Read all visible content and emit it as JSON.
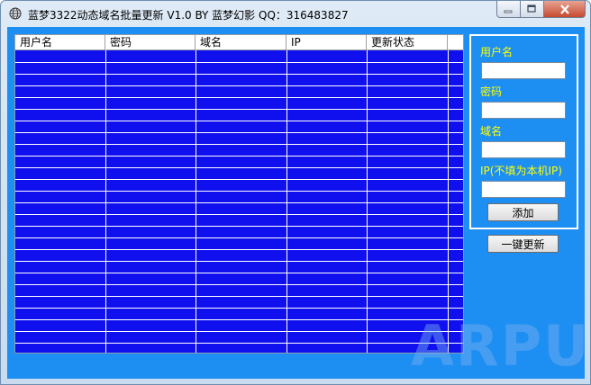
{
  "window": {
    "title": "蓝梦3322动态域名批量更新 V1.0 BY 蓝梦幻影 QQ：316483827",
    "icon": "globe-icon",
    "controls": [
      "minimize-icon",
      "maximize-icon",
      "close-icon"
    ]
  },
  "grid": {
    "columns": [
      "用户名",
      "密码",
      "域名",
      "IP",
      "更新状态"
    ],
    "rows": []
  },
  "form": {
    "username_label": "用户名",
    "username_value": "",
    "password_label": "密码",
    "password_value": "",
    "domain_label": "域名",
    "domain_value": "",
    "ip_label": "IP(不填为本机IP)",
    "ip_value": "",
    "add_button": "添加"
  },
  "update_all_button": "一键更新",
  "watermark": "ARPUN",
  "colors": {
    "client_background": "#1e8ff2",
    "grid_background": "#1010ee",
    "label_color": "#ffff00"
  }
}
